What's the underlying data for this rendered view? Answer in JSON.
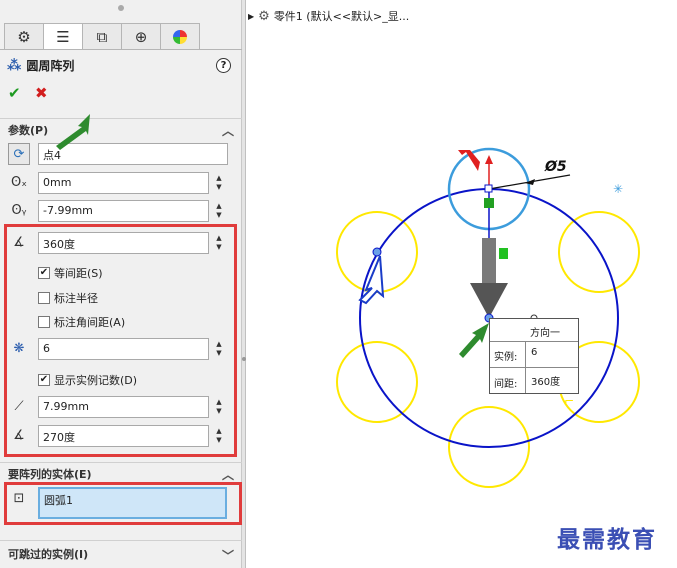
{
  "panel": {
    "tabs": [
      "feature-manager-icon",
      "property-manager-icon",
      "configuration-manager-icon",
      "dimxpert-icon",
      "display-manager-icon"
    ],
    "title": "圆周阵列",
    "help": "?",
    "ok": "✔",
    "cancel": "✖"
  },
  "params": {
    "header": "参数(P)",
    "point": "点4",
    "x_value": "0mm",
    "y_value": "-7.99mm",
    "angle": "360度",
    "equal_spacing": "等间距(S)",
    "dim_radius": "标注半径",
    "dim_angle_spacing": "标注角间距(A)",
    "instance_count": "6",
    "show_instance_count": "显示实例记数(D)",
    "radius": "7.99mm",
    "arc_angle": "270度"
  },
  "entities": {
    "header": "要阵列的实体(E)",
    "item": "圆弧1"
  },
  "skip": {
    "header": "可跳过的实例(I)"
  },
  "tree": {
    "label": "零件1 (默认<<默认>_显..."
  },
  "graphics": {
    "dimension": "Ø5",
    "callout_title": "方向一",
    "callout_count_label": "实例:",
    "callout_count_value": "6",
    "callout_spacing_label": "间距:",
    "callout_spacing_value": "360度"
  },
  "watermark": "最需教育",
  "colors": {
    "highlight_red": "#e03c3c",
    "pattern_circle": "#0a14c8",
    "instance_circle": "#ffe800",
    "selected_circle": "#3c9cdc",
    "arrow_green": "#2e8b2e",
    "arrow_red": "#e02020"
  }
}
